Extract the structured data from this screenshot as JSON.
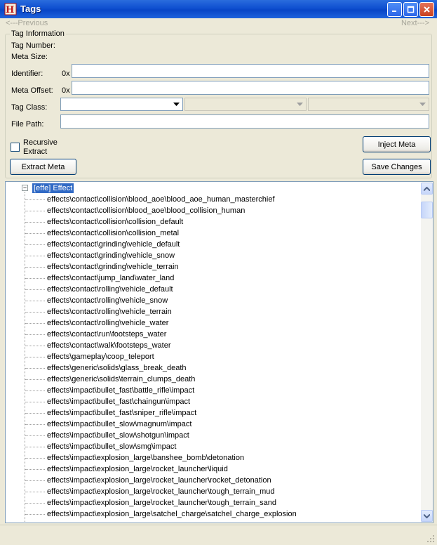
{
  "window": {
    "title": "Tags",
    "icon": "app-logo-icon"
  },
  "nav": {
    "previous": "<---Previous",
    "next": "Next--->"
  },
  "tag_info": {
    "group_title": "Tag Information",
    "tag_number_label": "Tag Number:",
    "meta_size_label": "Meta Size:",
    "identifier_label": "Identifier:",
    "identifier_prefix": "0x",
    "identifier_value": "",
    "meta_offset_label": "Meta Offset:",
    "meta_offset_prefix": "0x",
    "meta_offset_value": "",
    "tag_class_label": "Tag Class:",
    "file_path_label": "File Path:",
    "file_path_value": "",
    "recursive_extract_label_1": "Recursive",
    "recursive_extract_label_2": "Extract",
    "recursive_extract_checked": false,
    "extract_meta_button": "Extract Meta",
    "inject_meta_button": "Inject Meta",
    "save_changes_button": "Save Changes"
  },
  "tree": {
    "root_label": "[effe] Effect",
    "root_expanded": true,
    "items": [
      "effects\\contact\\collision\\blood_aoe\\blood_aoe_human_masterchief",
      "effects\\contact\\collision\\blood_aoe\\blood_collision_human",
      "effects\\contact\\collision\\collision_default",
      "effects\\contact\\collision\\collision_metal",
      "effects\\contact\\grinding\\vehicle_default",
      "effects\\contact\\grinding\\vehicle_snow",
      "effects\\contact\\grinding\\vehicle_terrain",
      "effects\\contact\\jump_land\\water_land",
      "effects\\contact\\rolling\\vehicle_default",
      "effects\\contact\\rolling\\vehicle_snow",
      "effects\\contact\\rolling\\vehicle_terrain",
      "effects\\contact\\rolling\\vehicle_water",
      "effects\\contact\\run\\footsteps_water",
      "effects\\contact\\walk\\footsteps_water",
      "effects\\gameplay\\coop_teleport",
      "effects\\generic\\solids\\glass_break_death",
      "effects\\generic\\solids\\terrain_clumps_death",
      "effects\\impact\\bullet_fast\\battle_rifle\\impact",
      "effects\\impact\\bullet_fast\\chaingun\\impact",
      "effects\\impact\\bullet_fast\\sniper_rifle\\impact",
      "effects\\impact\\bullet_slow\\magnum\\impact",
      "effects\\impact\\bullet_slow\\shotgun\\impact",
      "effects\\impact\\bullet_slow\\smg\\impact",
      "effects\\impact\\explosion_large\\banshee_bomb\\detonation",
      "effects\\impact\\explosion_large\\rocket_launcher\\liquid",
      "effects\\impact\\explosion_large\\rocket_launcher\\rocket_detonation",
      "effects\\impact\\explosion_large\\rocket_launcher\\tough_terrain_mud",
      "effects\\impact\\explosion_large\\rocket_launcher\\tough_terrain_sand",
      "effects\\impact\\explosion_large\\satchel_charge\\satchel_charge_explosion"
    ]
  },
  "colors": {
    "selection": "#316ac5",
    "window_face": "#ece9d8",
    "titlebar": "#0845c6"
  }
}
